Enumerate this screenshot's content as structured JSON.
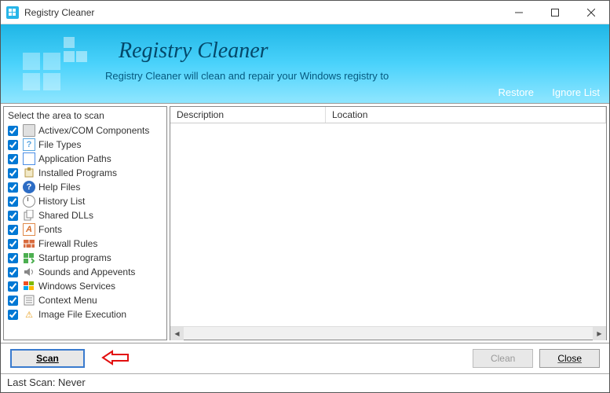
{
  "window": {
    "title": "Registry Cleaner"
  },
  "banner": {
    "title": "Registry Cleaner",
    "subtitle": "Registry Cleaner will clean and repair your Windows registry to",
    "restore": "Restore",
    "ignore": "Ignore List"
  },
  "left": {
    "header": "Select the area to scan",
    "items": [
      {
        "label": "Activex/COM Components",
        "icon": "activex"
      },
      {
        "label": "File Types",
        "icon": "filetypes"
      },
      {
        "label": "Application Paths",
        "icon": "apppaths"
      },
      {
        "label": "Installed Programs",
        "icon": "installed"
      },
      {
        "label": "Help Files",
        "icon": "help"
      },
      {
        "label": "History List",
        "icon": "history"
      },
      {
        "label": "Shared DLLs",
        "icon": "shared"
      },
      {
        "label": "Fonts",
        "icon": "fonts"
      },
      {
        "label": "Firewall Rules",
        "icon": "firewall"
      },
      {
        "label": "Startup programs",
        "icon": "startup"
      },
      {
        "label": "Sounds and Appevents",
        "icon": "sounds"
      },
      {
        "label": "Windows Services",
        "icon": "winservices"
      },
      {
        "label": "Context Menu",
        "icon": "context"
      },
      {
        "label": "Image File Execution",
        "icon": "imagefile"
      }
    ]
  },
  "right": {
    "col_description": "Description",
    "col_location": "Location"
  },
  "footer": {
    "scan": "Scan",
    "clean": "Clean",
    "close": "Close"
  },
  "status": {
    "last_scan": "Last Scan: Never"
  }
}
